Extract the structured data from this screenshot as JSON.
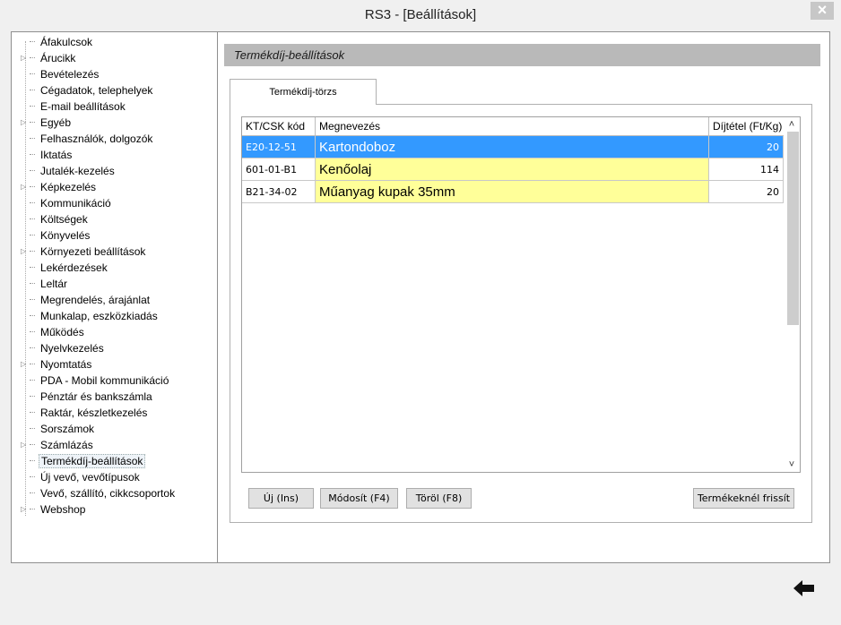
{
  "window": {
    "title": "RS3 - [Beállítások]",
    "close_label": "×"
  },
  "tree": {
    "items": [
      {
        "label": "Áfakulcsok",
        "expandable": false
      },
      {
        "label": "Árucikk",
        "expandable": true
      },
      {
        "label": "Bevételezés",
        "expandable": false
      },
      {
        "label": "Cégadatok, telephelyek",
        "expandable": false
      },
      {
        "label": "E-mail beállítások",
        "expandable": false
      },
      {
        "label": "Egyéb",
        "expandable": true
      },
      {
        "label": "Felhasználók, dolgozók",
        "expandable": false
      },
      {
        "label": "Iktatás",
        "expandable": false
      },
      {
        "label": "Jutalék-kezelés",
        "expandable": false
      },
      {
        "label": "Képkezelés",
        "expandable": true
      },
      {
        "label": "Kommunikáció",
        "expandable": false
      },
      {
        "label": "Költségek",
        "expandable": false
      },
      {
        "label": "Könyvelés",
        "expandable": false
      },
      {
        "label": "Környezeti beállítások",
        "expandable": true
      },
      {
        "label": "Lekérdezések",
        "expandable": false
      },
      {
        "label": "Leltár",
        "expandable": false
      },
      {
        "label": "Megrendelés, árajánlat",
        "expandable": false
      },
      {
        "label": "Munkalap, eszközkiadás",
        "expandable": false
      },
      {
        "label": "Működés",
        "expandable": false
      },
      {
        "label": "Nyelvkezelés",
        "expandable": false
      },
      {
        "label": "Nyomtatás",
        "expandable": true
      },
      {
        "label": "PDA - Mobil kommunikáció",
        "expandable": false
      },
      {
        "label": "Pénztár és bankszámla",
        "expandable": false
      },
      {
        "label": "Raktár, készletkezelés",
        "expandable": false
      },
      {
        "label": "Sorszámok",
        "expandable": false
      },
      {
        "label": "Számlázás",
        "expandable": true
      },
      {
        "label": "Termékdíj-beállítások",
        "expandable": false,
        "selected": true
      },
      {
        "label": "Új vevő, vevőtípusok",
        "expandable": false
      },
      {
        "label": "Vevő, szállító, cikkcsoportok",
        "expandable": false
      },
      {
        "label": "Webshop",
        "expandable": true
      }
    ]
  },
  "panel": {
    "header": "Termékdíj-beállítások",
    "tab": "Termékdíj-törzs"
  },
  "grid": {
    "columns": [
      "KT/CSK kód",
      "Megnevezés",
      "Díjtétel (Ft/Kg)"
    ],
    "rows": [
      {
        "code": "E20-12-51",
        "name": "Kartondoboz",
        "fee": "20",
        "selected": true
      },
      {
        "code": "601-01-B1",
        "name": "Kenőolaj",
        "fee": "114",
        "selected": false
      },
      {
        "code": "B21-34-02",
        "name": "Műanyag kupak 35mm",
        "fee": "20",
        "selected": false
      }
    ]
  },
  "buttons": {
    "new": "Új (Ins)",
    "edit": "Módosít (F4)",
    "delete": "Töröl (F8)",
    "refresh": "Termékeknél frissít"
  },
  "colors": {
    "selection": "#3399ff",
    "highlight_yellow": "#ffff99",
    "header_gray": "#b9b9b9"
  }
}
